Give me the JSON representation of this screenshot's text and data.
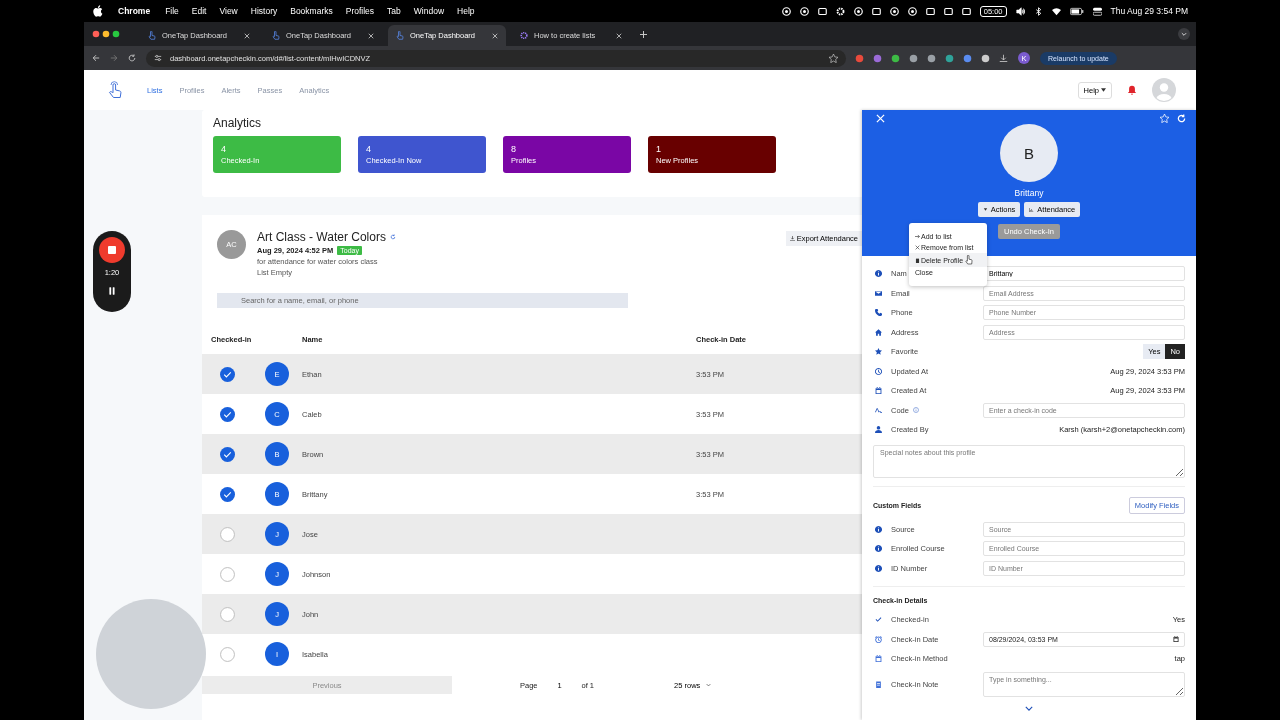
{
  "menu_bar": {
    "app": "Chrome",
    "menus": [
      "File",
      "Edit",
      "View",
      "History",
      "Bookmarks",
      "Profiles",
      "Tab",
      "Window",
      "Help"
    ],
    "timer": "05:00",
    "clock": "Thu Aug 29 3:54 PM"
  },
  "tabs": [
    {
      "title": "OneTap Dashboard",
      "selected": false
    },
    {
      "title": "OneTap Dashboard",
      "selected": false
    },
    {
      "title": "OneTap Dashboard",
      "selected": true
    },
    {
      "title": "How to create lists",
      "selected": false
    }
  ],
  "address_bar": {
    "url": "dashboard.onetapcheckin.com/d#/list-content/mIHwICDNVZ",
    "profile": "K",
    "update_button": "Relaunch to update"
  },
  "nav": {
    "links": [
      {
        "label": "Lists",
        "selected": true
      },
      {
        "label": "Profiles",
        "selected": false
      },
      {
        "label": "Alerts",
        "selected": false
      },
      {
        "label": "Passes",
        "selected": false
      },
      {
        "label": "Analytics",
        "selected": false
      }
    ],
    "help": "Help"
  },
  "recorder": {
    "time": "1:20"
  },
  "analytics": {
    "title": "Analytics",
    "tiles": [
      {
        "value": "4",
        "label": "Checked-In",
        "color": "#3dbb45"
      },
      {
        "value": "4",
        "label": "Checked-In Now",
        "color": "#3f55cf"
      },
      {
        "value": "8",
        "label": "Profiles",
        "color": "#7a06a5"
      },
      {
        "value": "1",
        "label": "New Profiles",
        "color": "#680000"
      }
    ]
  },
  "list": {
    "avatar": "AC",
    "title": "Art Class - Water Colors",
    "date": "Aug 29, 2024 4:52 PM",
    "badge": "Today",
    "description": "for attendance for water colors class",
    "status": "List Empty",
    "export_button": "Export Attendance",
    "search_placeholder": "Search for a name, email, or phone",
    "columns": [
      "Checked-in",
      "Name",
      "Check-in Date"
    ],
    "rows": [
      {
        "checked": true,
        "initial": "E",
        "name": "Ethan",
        "date": "3:53 PM"
      },
      {
        "checked": true,
        "initial": "C",
        "name": "Caleb",
        "date": "3:53 PM"
      },
      {
        "checked": true,
        "initial": "B",
        "name": "Brown",
        "date": "3:53 PM"
      },
      {
        "checked": true,
        "initial": "B",
        "name": "Brittany",
        "date": "3:53 PM"
      },
      {
        "checked": false,
        "initial": "J",
        "name": "Jose"
      },
      {
        "checked": false,
        "initial": "J",
        "name": "Johnson"
      },
      {
        "checked": false,
        "initial": "J",
        "name": "John"
      },
      {
        "checked": false,
        "initial": "I",
        "name": "Isabella"
      }
    ]
  },
  "pagination": {
    "previous": "Previous",
    "previous_disabled": true,
    "page_label": "Page",
    "page": "1",
    "of": "of 1",
    "rows": "25 rows"
  },
  "profile": {
    "initial": "B",
    "name": "Brittany",
    "actions_button": "Actions",
    "attendance_button": "Attendance",
    "undo_button": "Undo Check-In",
    "menu": [
      {
        "kind": "add",
        "label": "Add to list",
        "hovered": false
      },
      {
        "kind": "remove",
        "label": "Remove from list",
        "hovered": false
      },
      {
        "kind": "delete",
        "label": "Delete Profile",
        "hovered": true
      },
      {
        "kind": "close",
        "label": "Close",
        "hovered": false
      }
    ],
    "fields": [
      {
        "kind": "input",
        "label": "Nam",
        "value": "Brittany"
      },
      {
        "kind": "input",
        "label": "Email",
        "placeholder": "Email Address"
      },
      {
        "kind": "input",
        "label": "Phone",
        "placeholder": "Phone Number"
      },
      {
        "kind": "input",
        "label": "Address",
        "placeholder": "Address"
      },
      {
        "kind": "toggle",
        "label": "Favorite",
        "options": [
          {
            "label": "Yes",
            "selected": false
          },
          {
            "label": "No",
            "selected": true
          }
        ]
      },
      {
        "kind": "text",
        "label": "Updated At",
        "value": "Aug 29, 2024 3:53 PM"
      },
      {
        "kind": "text",
        "label": "Created At",
        "value": "Aug 29, 2024 3:53 PM"
      },
      {
        "kind": "input",
        "label": "Code",
        "info": true,
        "placeholder": "Enter a check-in code"
      },
      {
        "kind": "text",
        "label": "Created By",
        "value": "Karsh (karsh+2@onetapcheckin.com)"
      }
    ],
    "notes_placeholder": "Special notes about this profile",
    "custom_fields": {
      "title": "Custom Fields",
      "button": "Modify Fields",
      "fields": [
        {
          "kind": "input",
          "label": "Source",
          "placeholder": "Source"
        },
        {
          "kind": "input",
          "label": "Enrolled Course",
          "placeholder": "Enrolled Course"
        },
        {
          "kind": "input",
          "label": "ID Number",
          "placeholder": "ID Number"
        }
      ]
    },
    "checkin": {
      "title": "Check-in Details",
      "fields": [
        {
          "kind": "text",
          "label": "Checked-in",
          "value": "Yes"
        },
        {
          "kind": "date",
          "label": "Check-in Date",
          "value": "08/29/2024, 03:53 PM"
        },
        {
          "kind": "text",
          "label": "Check-in Method",
          "value": "tap"
        },
        {
          "kind": "textarea",
          "label": "Check-in Note",
          "placeholder": "Type in something..."
        }
      ]
    }
  }
}
